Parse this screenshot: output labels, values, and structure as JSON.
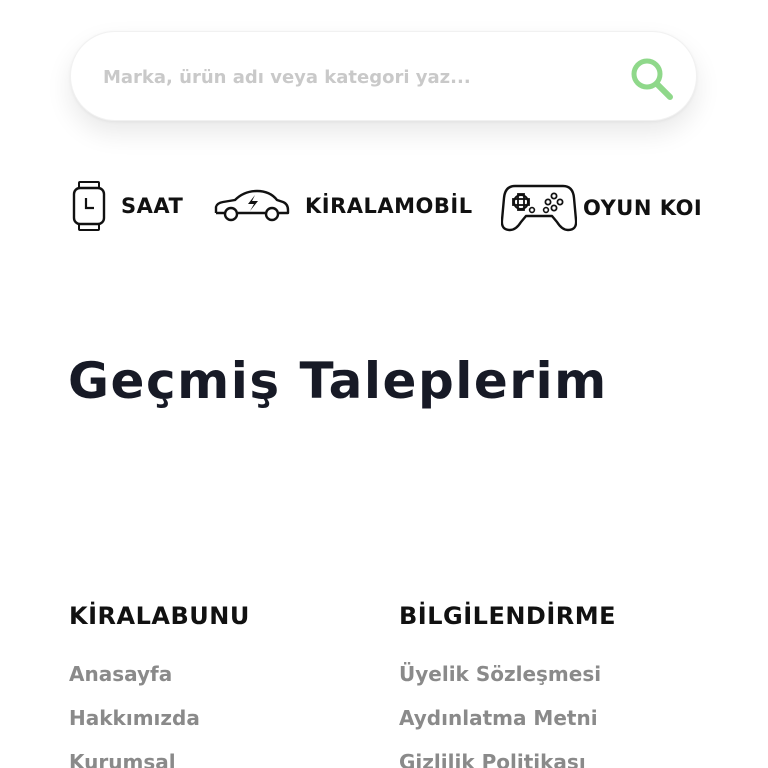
{
  "search": {
    "placeholder": "Marka, ürün adı veya kategori yaz...",
    "icon": "search-icon",
    "icon_color": "#8fd88a"
  },
  "categories": [
    {
      "label": "SAAT",
      "icon": "watch-icon"
    },
    {
      "label": "KİRALAMOBİL",
      "icon": "electric-car-icon"
    },
    {
      "label": "OYUN KOI",
      "icon": "gamepad-icon"
    }
  ],
  "page_title": "Geçmiş Taleplerim",
  "footer": {
    "columns": [
      {
        "heading": "KİRALABUNU",
        "links": [
          "Anasayfa",
          "Hakkımızda",
          "Kurumsal"
        ]
      },
      {
        "heading": "BİLGİLENDİRME",
        "links": [
          "Üyelik Sözleşmesi",
          "Aydınlatma Metni",
          "Gizlilik Politikası"
        ]
      }
    ]
  },
  "colors": {
    "title": "#171a26",
    "link": "#8a8a8a",
    "accent": "#8fd88a"
  }
}
